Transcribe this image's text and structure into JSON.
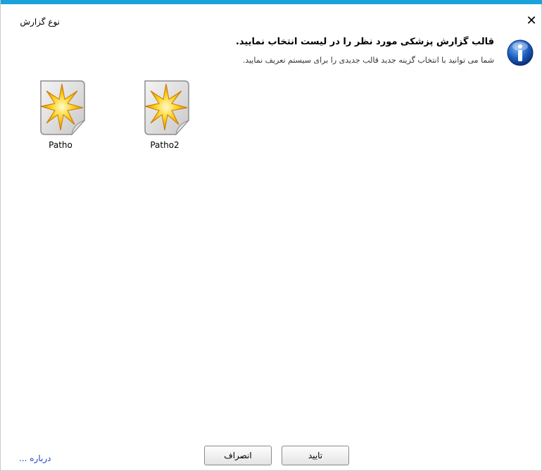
{
  "window": {
    "title": "نوع گزارش",
    "close_glyph": "✕"
  },
  "message": {
    "title": "قالب گزارش پزشکی مورد نظر را در لیست انتخاب نمایید.",
    "subtitle": "شما می توانید با انتخاب گزینه جدید قالب جدیدی را برای سیستم تعریف نمایید.",
    "icon": "info-icon"
  },
  "templates": [
    {
      "label": "Patho",
      "icon": "new-document-star-icon"
    },
    {
      "label": "Patho2",
      "icon": "new-document-star-icon"
    }
  ],
  "footer": {
    "cancel_label": "انصراف",
    "confirm_label": "تایید",
    "about_label": "درباره ..."
  },
  "colors": {
    "accent": "#1aa3d8",
    "link": "#1d3ec8",
    "info": "#1b5fbf"
  }
}
